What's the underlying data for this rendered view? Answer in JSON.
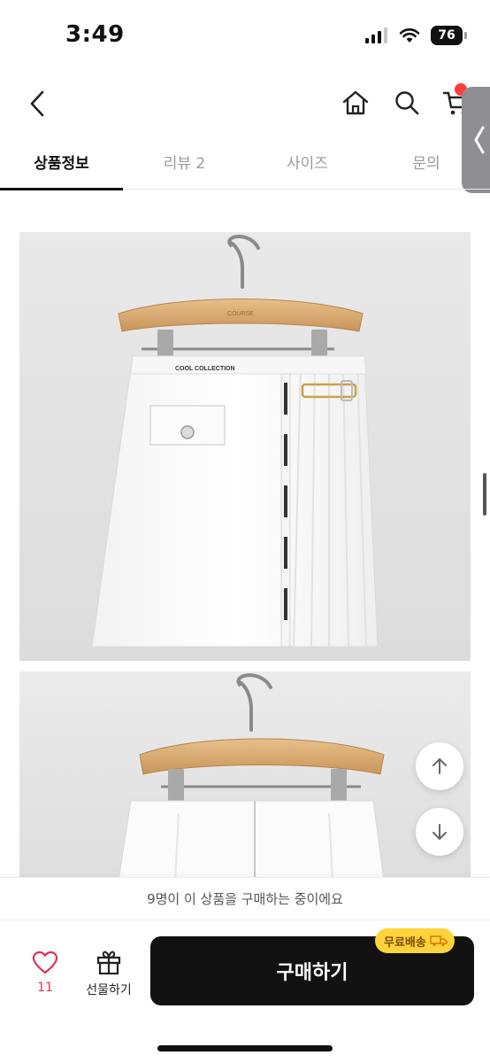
{
  "status_bar": {
    "time": "3:49",
    "battery_level": "76"
  },
  "header": {
    "back_icon": "chevron-left-icon",
    "home_icon": "home-icon",
    "search_icon": "search-icon",
    "cart_icon": "cart-icon"
  },
  "tabs": [
    {
      "label": "상품정보",
      "active": true
    },
    {
      "label": "리뷰 2",
      "active": false
    },
    {
      "label": "사이즈",
      "active": false
    },
    {
      "label": "문의",
      "active": false
    }
  ],
  "floating_buttons": {
    "up_icon": "arrow-up-icon",
    "down_icon": "arrow-down-icon"
  },
  "notice": {
    "text": "9명이 이 상품을 구매하는 중이에요"
  },
  "bottom_bar": {
    "like_count": "11",
    "gift_label": "선물하기",
    "buy_label": "구매하기",
    "shipping_badge": "무료배송"
  },
  "product_photo": {
    "trim_text": "COOL COLLECTION",
    "hanger_brand": "COURSE"
  },
  "colors": {
    "accent": "#121212",
    "like": "#e0314f",
    "badge": "#ffd43b",
    "cart_badge": "#ff3b3b"
  }
}
